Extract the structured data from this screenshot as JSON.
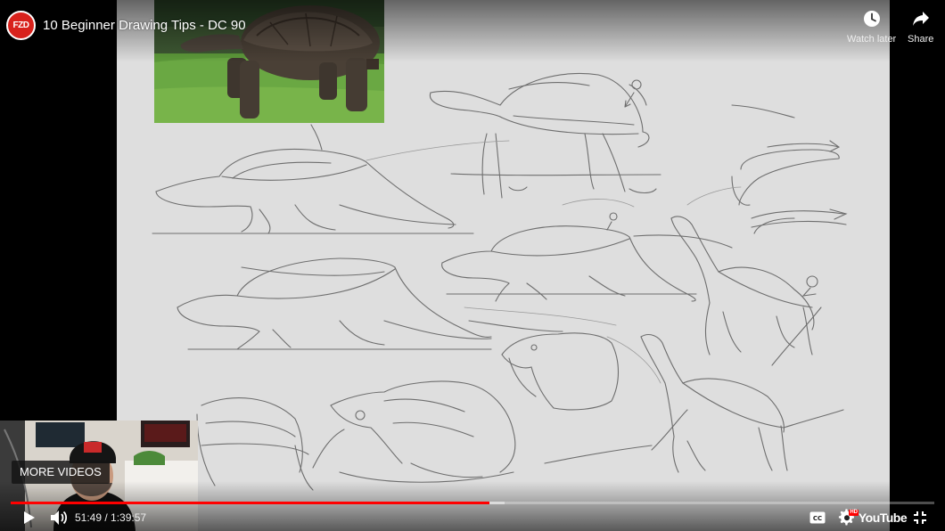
{
  "channel": {
    "logo_text": "FZD",
    "logo_color": "#d8221c"
  },
  "video": {
    "title": "10 Beginner Drawing Tips - DC 90"
  },
  "top_actions": {
    "watch_later": {
      "label": "Watch later",
      "icon": "clock-icon"
    },
    "share": {
      "label": "Share",
      "icon": "share-arrow-icon"
    }
  },
  "overlay": {
    "more_videos_label": "MORE VIDEOS"
  },
  "controls": {
    "time_display": "51:49 / 1:39:57",
    "progress_played_fraction": 0.5184,
    "progress_loaded_fraction": 0.535,
    "play_icon": "play-icon",
    "volume_icon": "volume-icon",
    "cc_label": "CC",
    "hd_badge": "HD",
    "brand_label": "YouTube",
    "fullscreen_icon": "exit-fullscreen-icon"
  },
  "colors": {
    "progress_red": "#ff0000",
    "paper": "#dedede"
  }
}
